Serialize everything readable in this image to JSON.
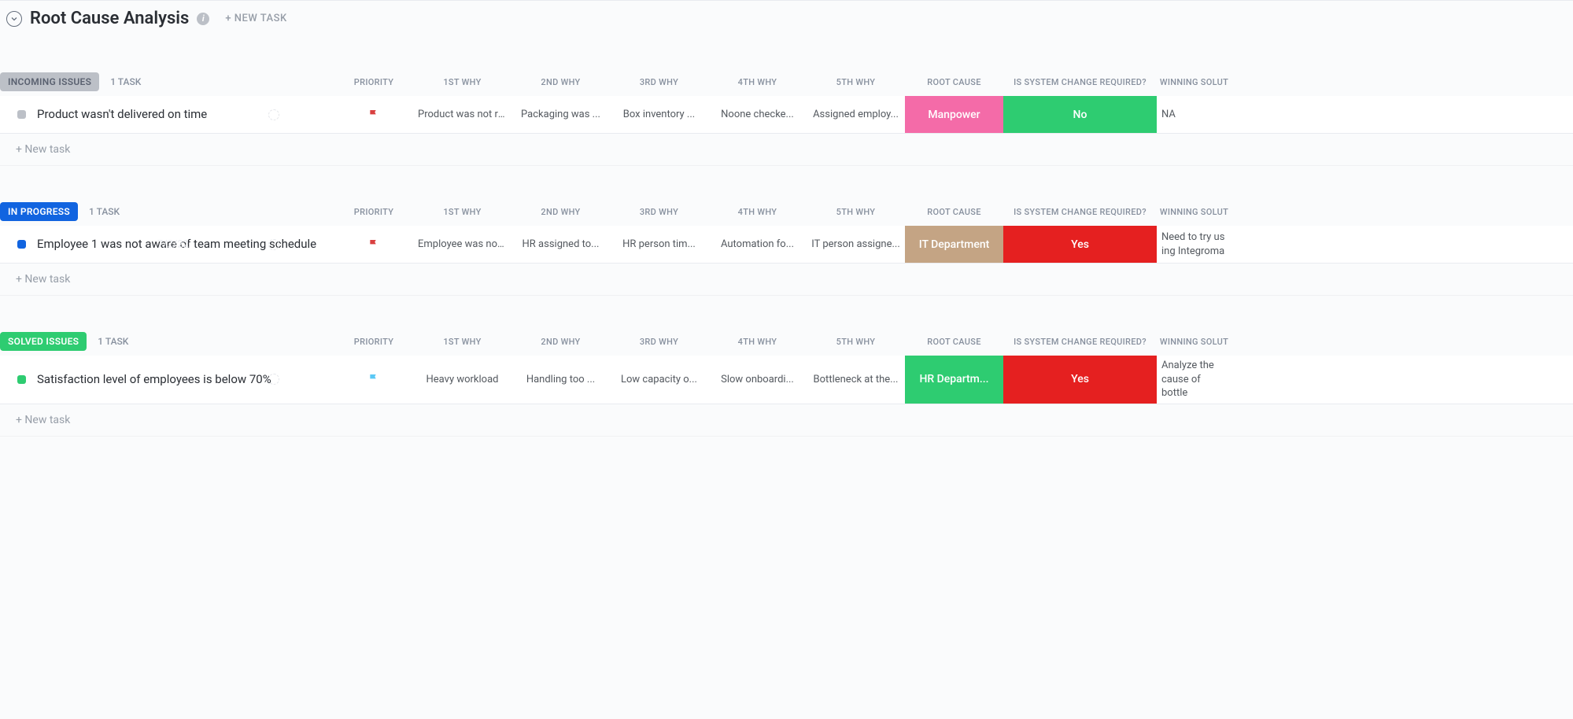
{
  "header": {
    "title": "Root Cause Analysis",
    "new_task_label": "+ NEW TASK"
  },
  "columns": {
    "priority": "PRIORITY",
    "why1": "1ST WHY",
    "why2": "2ND WHY",
    "why3": "3RD WHY",
    "why4": "4TH WHY",
    "why5": "5TH WHY",
    "root_cause": "ROOT CAUSE",
    "system_change": "IS SYSTEM CHANGE REQUIRED?",
    "winning_solution": "WINNING SOLUT"
  },
  "new_task_row": "+ New task",
  "groups": [
    {
      "status_label": "INCOMING ISSUES",
      "status_color": "gray",
      "task_count": "1 TASK",
      "tasks": [
        {
          "name": "Product wasn't delivered on time",
          "priority_flag_color": "#d94040",
          "why1": "Product was not rea...",
          "why2": "Packaging was ...",
          "why3": "Box inventory ...",
          "why4": "Noone checke...",
          "why5": "Assigned employ...",
          "root_cause": "Manpower",
          "root_cause_bg": "bg-pink",
          "system_change": "No",
          "system_change_bg": "bg-green2",
          "winning_solution": "NA"
        }
      ]
    },
    {
      "status_label": "IN PROGRESS",
      "status_color": "blue",
      "task_count": "1 TASK",
      "tasks": [
        {
          "name": "Employee 1 was not aware of team meeting schedule",
          "faint_date": "7/2/22",
          "priority_flag_color": "#d94040",
          "why1": "Employee was not b...",
          "why2": "HR assigned to...",
          "why3": "HR person tim...",
          "why4": "Automation fo...",
          "why5": "IT person assigne...",
          "root_cause": "IT Department",
          "root_cause_bg": "bg-tan",
          "system_change": "Yes",
          "system_change_bg": "bg-red",
          "winning_solution": "Need to try us ing Integroma"
        }
      ]
    },
    {
      "status_label": "SOLVED ISSUES",
      "status_color": "green",
      "task_count": "1 TASK",
      "tasks": [
        {
          "name": "Satisfaction level of employees is below 70%",
          "priority_flag_color": "#5ac8f5",
          "why1": "Heavy workload",
          "why2": "Handling too ...",
          "why3": "Low capacity o...",
          "why4": "Slow onboardi...",
          "why5": "Bottleneck at the...",
          "root_cause": "HR Departm...",
          "root_cause_bg": "bg-green2",
          "system_change": "Yes",
          "system_change_bg": "bg-red",
          "winning_solution": "Analyze the cause of bottle"
        }
      ]
    }
  ]
}
